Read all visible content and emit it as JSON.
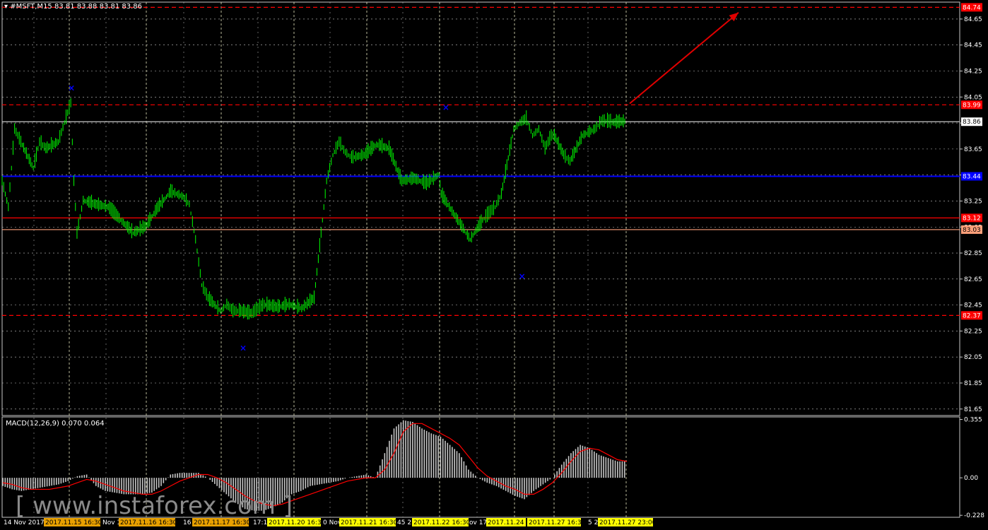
{
  "header": {
    "symbol_line": "#MSFT,M15  83.81 83.88 83.81 83.86"
  },
  "macd_header": "MACD(12,26,9) 0.070 0.064",
  "watermark": "[ www.instaforex.com ]",
  "colors": {
    "background": "#000000",
    "grid": "#c8c8c8",
    "candle": "#00ff00",
    "support_blue": "#0000ff",
    "level_red": "#ff0000",
    "level_orange": "#ffa07a",
    "marker": "#0000ff",
    "arrow": "#e00000",
    "hist": "#c8c8c8",
    "signal": "#ff0000"
  },
  "chart_data": {
    "type": "line",
    "price_axis": {
      "ticks": [
        "84.65",
        "84.45",
        "84.25",
        "84.05",
        "83.85",
        "83.65",
        "83.45",
        "83.25",
        "83.05",
        "82.85",
        "82.65",
        "82.45",
        "82.25",
        "82.05",
        "81.85",
        "81.65"
      ],
      "range": [
        81.6,
        84.78
      ]
    },
    "price_labels": [
      {
        "value": 84.74,
        "text": "84.74",
        "kind": "red"
      },
      {
        "value": 83.99,
        "text": "83.99",
        "kind": "red"
      },
      {
        "value": 83.86,
        "text": "83.86",
        "kind": "current"
      },
      {
        "value": 83.44,
        "text": "83.44",
        "kind": "blue"
      },
      {
        "value": 83.12,
        "text": "83.12",
        "kind": "red"
      },
      {
        "value": 83.03,
        "text": "83.03",
        "kind": "orange"
      },
      {
        "value": 82.37,
        "text": "82.37",
        "kind": "red"
      }
    ],
    "levels": [
      {
        "value": 84.74,
        "style": "dashed",
        "color": "#ff0000"
      },
      {
        "value": 83.99,
        "style": "dashed",
        "color": "#ff0000"
      },
      {
        "value": 83.86,
        "style": "solid",
        "color": "#c8c8c8"
      },
      {
        "value": 83.44,
        "style": "solid",
        "color": "#0000ff"
      },
      {
        "value": 83.12,
        "style": "solid",
        "color": "#ff0000"
      },
      {
        "value": 83.03,
        "style": "solid",
        "color": "#ffa07a"
      },
      {
        "value": 82.37,
        "style": "dashed",
        "color": "#ff0000"
      }
    ],
    "series": [
      {
        "x": [
          0,
          0.01,
          0.02,
          0.03,
          0.05,
          0.06,
          0.07,
          0.09,
          0.1,
          0.11,
          0.115,
          0.12,
          0.13,
          0.15,
          0.17,
          0.19,
          0.21,
          0.23,
          0.25,
          0.27,
          0.29,
          0.3,
          0.31,
          0.32,
          0.33,
          0.35,
          0.36,
          0.37,
          0.38,
          0.4,
          0.41,
          0.42,
          0.44,
          0.46,
          0.48,
          0.5,
          0.52,
          0.53,
          0.54,
          0.55,
          0.56,
          0.58,
          0.6,
          0.62,
          0.64,
          0.66,
          0.68,
          0.7,
          0.7035,
          0.71,
          0.73,
          0.75,
          0.77,
          0.78,
          0.79,
          0.8,
          0.82,
          0.83,
          0.84,
          0.85,
          0.86,
          0.87,
          0.88,
          0.885,
          0.9,
          0.91,
          0.93,
          0.95,
          0.96,
          0.97,
          0.98,
          1.0
        ],
        "y": [
          83.4,
          83.2,
          83.8,
          83.7,
          83.5,
          83.7,
          83.65,
          83.7,
          83.85,
          84.0,
          83.4,
          83.0,
          83.25,
          83.22,
          83.2,
          83.1,
          83.0,
          83.05,
          83.2,
          83.32,
          83.28,
          83.22,
          82.95,
          82.6,
          82.5,
          82.4,
          82.45,
          82.4,
          82.4,
          82.38,
          82.42,
          82.45,
          82.43,
          82.45,
          82.42,
          82.5,
          83.4,
          83.6,
          83.7,
          83.62,
          83.58,
          83.6,
          83.68,
          83.65,
          83.4,
          83.42,
          83.38,
          83.45,
          83.3,
          83.25,
          83.1,
          82.95,
          83.1,
          83.15,
          83.2,
          83.3,
          83.8,
          83.85,
          83.88,
          83.75,
          83.8,
          83.65,
          83.75,
          83.75,
          83.6,
          83.55,
          83.75,
          83.8,
          83.86,
          83.86,
          83.85,
          83.86
        ],
        "name": ""
      }
    ],
    "markers": [
      {
        "x": 0.11,
        "y": 84.12
      },
      {
        "x": 0.385,
        "y": 82.12
      },
      {
        "x": 0.71,
        "y": 83.97
      },
      {
        "x": 0.832,
        "y": 82.67
      }
    ],
    "arrow": {
      "from_x": 1.0,
      "from_y": 84.0,
      "to_x": 1.18,
      "to_y": 84.7
    },
    "macd": {
      "label": "MACD(12,26,9)",
      "ticks": [
        "0.355",
        "0.00",
        "-0.228"
      ],
      "range": [
        -0.24,
        0.37
      ],
      "histogram": [
        -0.05,
        -0.07,
        -0.08,
        -0.07,
        -0.06,
        -0.05,
        -0.04,
        -0.02,
        0.01,
        0.02,
        -0.05,
        -0.08,
        -0.09,
        -0.1,
        -0.1,
        -0.1,
        -0.09,
        -0.05,
        0.02,
        0.03,
        0.03,
        0.03,
        0.0,
        -0.05,
        -0.1,
        -0.15,
        -0.19,
        -0.2,
        -0.2,
        -0.18,
        -0.15,
        -0.1,
        -0.08,
        -0.05,
        -0.04,
        -0.03,
        -0.02,
        0.0,
        0.01,
        0.02,
        0.0,
        0.15,
        0.3,
        0.35,
        0.34,
        0.3,
        0.27,
        0.25,
        0.2,
        0.15,
        0.05,
        0.0,
        -0.03,
        -0.05,
        -0.08,
        -0.11,
        -0.13,
        -0.08,
        -0.04,
        0.0,
        0.08,
        0.15,
        0.2,
        0.18,
        0.14,
        0.12,
        0.1,
        0.1
      ],
      "signal": [
        -0.03,
        -0.04,
        -0.06,
        -0.07,
        -0.07,
        -0.07,
        -0.06,
        -0.05,
        -0.03,
        -0.01,
        -0.02,
        -0.04,
        -0.06,
        -0.08,
        -0.09,
        -0.1,
        -0.1,
        -0.08,
        -0.05,
        -0.02,
        0.0,
        0.02,
        0.02,
        0.0,
        -0.03,
        -0.07,
        -0.11,
        -0.14,
        -0.16,
        -0.17,
        -0.16,
        -0.14,
        -0.12,
        -0.1,
        -0.08,
        -0.06,
        -0.04,
        -0.02,
        -0.01,
        0.0,
        0.0,
        0.05,
        0.15,
        0.28,
        0.33,
        0.33,
        0.3,
        0.27,
        0.24,
        0.2,
        0.13,
        0.06,
        0.01,
        -0.02,
        -0.05,
        -0.07,
        -0.1,
        -0.1,
        -0.07,
        -0.03,
        0.03,
        0.1,
        0.16,
        0.18,
        0.17,
        0.14,
        0.11,
        0.1
      ]
    },
    "time_labels": [
      {
        "text": "14 Nov 2017",
        "highlight": "none"
      },
      {
        "text": "2017.11.15 16:30",
        "highlight": "orange"
      },
      {
        "text": "Nov 1",
        "highlight": "none"
      },
      {
        "text": "2017.11.16 16:30",
        "highlight": "orange"
      },
      {
        "text": "16",
        "highlight": "none"
      },
      {
        "text": "2017.11.17 16:30",
        "highlight": "orange"
      },
      {
        "text": "17:1",
        "highlight": "none"
      },
      {
        "text": "2017.11.20 16:30",
        "highlight": "yellow"
      },
      {
        "text": "0 Nov",
        "highlight": "none"
      },
      {
        "text": "2017.11.21 16:30",
        "highlight": "yellow"
      },
      {
        "text": "45  2",
        "highlight": "none"
      },
      {
        "text": "2017.11.22 16:30",
        "highlight": "yellow"
      },
      {
        "text": "ov 17",
        "highlight": "none"
      },
      {
        "text": "2017.11.24 1",
        "highlight": "yellow"
      },
      {
        "text": "2017.11.27 16:30",
        "highlight": "yellow"
      },
      {
        "text": "5  27",
        "highlight": "none"
      },
      {
        "text": "2017.11.27 23:00",
        "highlight": "yellow"
      }
    ]
  }
}
